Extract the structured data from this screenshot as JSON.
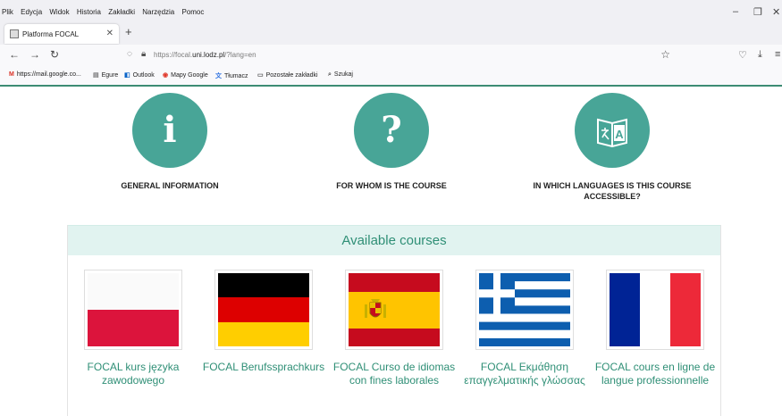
{
  "browser": {
    "menu": [
      "Plik",
      "Edycja",
      "Widok",
      "Historia",
      "Zakładki",
      "Narzędzia",
      "Pomoc"
    ],
    "tab_title": "Platforma FOCAL",
    "url_prefix": "https://focal.",
    "url_domain": "uni.lodz.pl",
    "url_suffix": "/?lang=en",
    "bookmarks": [
      "https://mail.google.co...",
      "Egure",
      "Outlook",
      "Mapy Google",
      "Tłumacz",
      "Pozostałe zakładki",
      "Szukaj"
    ]
  },
  "info_sections": [
    {
      "icon": "info-icon",
      "glyph": "i",
      "label": "GENERAL INFORMATION"
    },
    {
      "icon": "question-icon",
      "glyph": "?",
      "label": "FOR WHOM IS THE COURSE"
    },
    {
      "icon": "translate-icon",
      "glyph": "A",
      "label": "IN WHICH LANGUAGES IS THIS COURSE ACCESSIBLE?"
    }
  ],
  "courses": {
    "heading": "Available courses",
    "items": [
      {
        "flag": "poland-flag",
        "name": "FOCAL kurs języka zawodowego"
      },
      {
        "flag": "germany-flag",
        "name": "FOCAL Berufssprachkurs"
      },
      {
        "flag": "spain-flag",
        "name": "FOCAL Curso de idiomas con fines laborales"
      },
      {
        "flag": "greece-flag",
        "name": "FOCAL Εκμάθηση επαγγελματικής γλώσσας"
      },
      {
        "flag": "france-flag",
        "name": "FOCAL cours en ligne de langue professionnelle"
      }
    ]
  },
  "colors": {
    "accent": "#48a597",
    "link": "#2f8f76",
    "header_bg": "#e1f3f0"
  }
}
